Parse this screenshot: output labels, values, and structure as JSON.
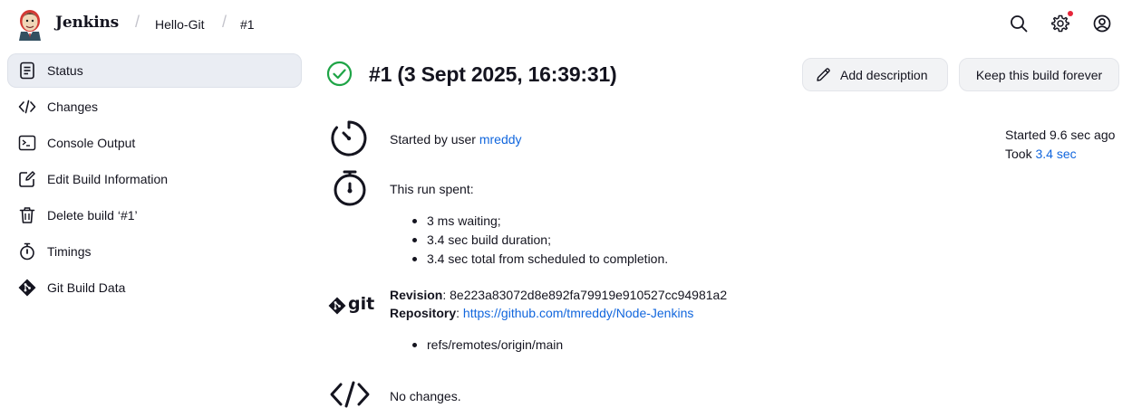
{
  "header": {
    "brand": "Jenkins",
    "breadcrumbs": [
      "Hello-Git",
      "#1"
    ],
    "icons": [
      "search-icon",
      "settings-icon",
      "user-icon"
    ],
    "notification_color": "#e6263a"
  },
  "sidebar": {
    "items": [
      {
        "label": "Status",
        "icon": "status-document-icon",
        "active": true
      },
      {
        "label": "Changes",
        "icon": "code-icon"
      },
      {
        "label": "Console Output",
        "icon": "terminal-icon"
      },
      {
        "label": "Edit Build Information",
        "icon": "edit-icon"
      },
      {
        "label": "Delete build ‘#1’",
        "icon": "trash-icon"
      },
      {
        "label": "Timings",
        "icon": "stopwatch-icon"
      },
      {
        "label": "Git Build Data",
        "icon": "git-icon"
      }
    ]
  },
  "build": {
    "title": "#1 (3 Sept 2025, 16:39:31)",
    "status": "success",
    "status_color": "#1ea446",
    "add_description_label": "Add description",
    "keep_forever_label": "Keep this build forever",
    "started_prefix": "Started by user ",
    "started_user": "mreddy",
    "started_ago": "Started 9.6 sec ago",
    "took_prefix": "Took ",
    "took_value": "3.4 sec",
    "run_spent_label": "This run spent:",
    "run_spent_items": [
      "3 ms waiting;",
      "3.4 sec build duration;",
      "3.4 sec total from scheduled to completion."
    ],
    "revision_label": "Revision",
    "revision_value": ": 8e223a83072d8e892fa79919e910527cc94981a2",
    "repository_label": "Repository",
    "repository_sep": ": ",
    "repository_url": "https://github.com/tmreddy/Node-Jenkins",
    "refs": [
      "refs/remotes/origin/main"
    ],
    "changes_text": "No changes.",
    "git_logo_text": "git"
  },
  "colors": {
    "link": "#1166dd",
    "sidebar_active": "#eaedf3",
    "button_bg": "#f2f3f5"
  }
}
